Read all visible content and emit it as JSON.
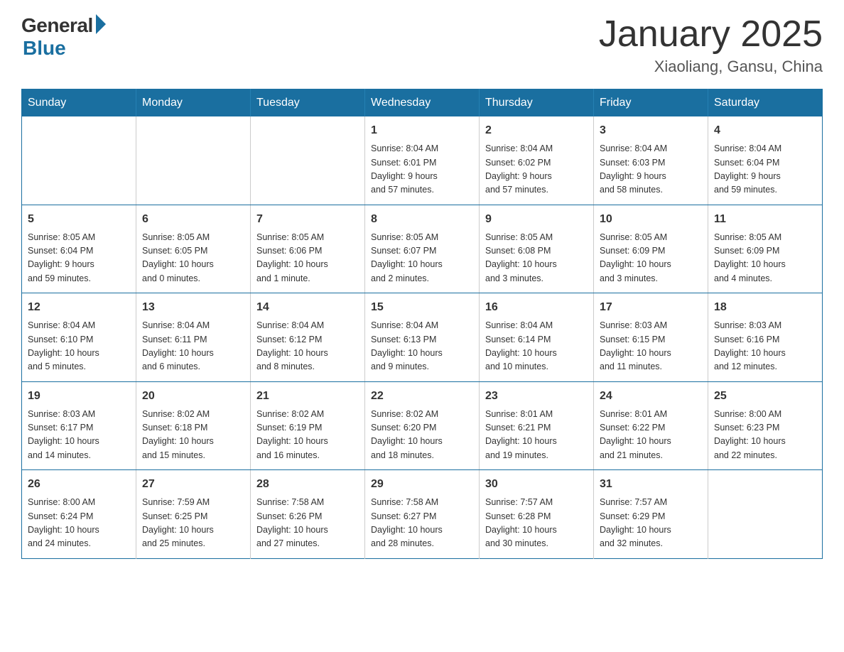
{
  "logo": {
    "general": "General",
    "blue": "Blue"
  },
  "title": "January 2025",
  "location": "Xiaoliang, Gansu, China",
  "days_of_week": [
    "Sunday",
    "Monday",
    "Tuesday",
    "Wednesday",
    "Thursday",
    "Friday",
    "Saturday"
  ],
  "weeks": [
    [
      {
        "day": "",
        "info": ""
      },
      {
        "day": "",
        "info": ""
      },
      {
        "day": "",
        "info": ""
      },
      {
        "day": "1",
        "info": "Sunrise: 8:04 AM\nSunset: 6:01 PM\nDaylight: 9 hours\nand 57 minutes."
      },
      {
        "day": "2",
        "info": "Sunrise: 8:04 AM\nSunset: 6:02 PM\nDaylight: 9 hours\nand 57 minutes."
      },
      {
        "day": "3",
        "info": "Sunrise: 8:04 AM\nSunset: 6:03 PM\nDaylight: 9 hours\nand 58 minutes."
      },
      {
        "day": "4",
        "info": "Sunrise: 8:04 AM\nSunset: 6:04 PM\nDaylight: 9 hours\nand 59 minutes."
      }
    ],
    [
      {
        "day": "5",
        "info": "Sunrise: 8:05 AM\nSunset: 6:04 PM\nDaylight: 9 hours\nand 59 minutes."
      },
      {
        "day": "6",
        "info": "Sunrise: 8:05 AM\nSunset: 6:05 PM\nDaylight: 10 hours\nand 0 minutes."
      },
      {
        "day": "7",
        "info": "Sunrise: 8:05 AM\nSunset: 6:06 PM\nDaylight: 10 hours\nand 1 minute."
      },
      {
        "day": "8",
        "info": "Sunrise: 8:05 AM\nSunset: 6:07 PM\nDaylight: 10 hours\nand 2 minutes."
      },
      {
        "day": "9",
        "info": "Sunrise: 8:05 AM\nSunset: 6:08 PM\nDaylight: 10 hours\nand 3 minutes."
      },
      {
        "day": "10",
        "info": "Sunrise: 8:05 AM\nSunset: 6:09 PM\nDaylight: 10 hours\nand 3 minutes."
      },
      {
        "day": "11",
        "info": "Sunrise: 8:05 AM\nSunset: 6:09 PM\nDaylight: 10 hours\nand 4 minutes."
      }
    ],
    [
      {
        "day": "12",
        "info": "Sunrise: 8:04 AM\nSunset: 6:10 PM\nDaylight: 10 hours\nand 5 minutes."
      },
      {
        "day": "13",
        "info": "Sunrise: 8:04 AM\nSunset: 6:11 PM\nDaylight: 10 hours\nand 6 minutes."
      },
      {
        "day": "14",
        "info": "Sunrise: 8:04 AM\nSunset: 6:12 PM\nDaylight: 10 hours\nand 8 minutes."
      },
      {
        "day": "15",
        "info": "Sunrise: 8:04 AM\nSunset: 6:13 PM\nDaylight: 10 hours\nand 9 minutes."
      },
      {
        "day": "16",
        "info": "Sunrise: 8:04 AM\nSunset: 6:14 PM\nDaylight: 10 hours\nand 10 minutes."
      },
      {
        "day": "17",
        "info": "Sunrise: 8:03 AM\nSunset: 6:15 PM\nDaylight: 10 hours\nand 11 minutes."
      },
      {
        "day": "18",
        "info": "Sunrise: 8:03 AM\nSunset: 6:16 PM\nDaylight: 10 hours\nand 12 minutes."
      }
    ],
    [
      {
        "day": "19",
        "info": "Sunrise: 8:03 AM\nSunset: 6:17 PM\nDaylight: 10 hours\nand 14 minutes."
      },
      {
        "day": "20",
        "info": "Sunrise: 8:02 AM\nSunset: 6:18 PM\nDaylight: 10 hours\nand 15 minutes."
      },
      {
        "day": "21",
        "info": "Sunrise: 8:02 AM\nSunset: 6:19 PM\nDaylight: 10 hours\nand 16 minutes."
      },
      {
        "day": "22",
        "info": "Sunrise: 8:02 AM\nSunset: 6:20 PM\nDaylight: 10 hours\nand 18 minutes."
      },
      {
        "day": "23",
        "info": "Sunrise: 8:01 AM\nSunset: 6:21 PM\nDaylight: 10 hours\nand 19 minutes."
      },
      {
        "day": "24",
        "info": "Sunrise: 8:01 AM\nSunset: 6:22 PM\nDaylight: 10 hours\nand 21 minutes."
      },
      {
        "day": "25",
        "info": "Sunrise: 8:00 AM\nSunset: 6:23 PM\nDaylight: 10 hours\nand 22 minutes."
      }
    ],
    [
      {
        "day": "26",
        "info": "Sunrise: 8:00 AM\nSunset: 6:24 PM\nDaylight: 10 hours\nand 24 minutes."
      },
      {
        "day": "27",
        "info": "Sunrise: 7:59 AM\nSunset: 6:25 PM\nDaylight: 10 hours\nand 25 minutes."
      },
      {
        "day": "28",
        "info": "Sunrise: 7:58 AM\nSunset: 6:26 PM\nDaylight: 10 hours\nand 27 minutes."
      },
      {
        "day": "29",
        "info": "Sunrise: 7:58 AM\nSunset: 6:27 PM\nDaylight: 10 hours\nand 28 minutes."
      },
      {
        "day": "30",
        "info": "Sunrise: 7:57 AM\nSunset: 6:28 PM\nDaylight: 10 hours\nand 30 minutes."
      },
      {
        "day": "31",
        "info": "Sunrise: 7:57 AM\nSunset: 6:29 PM\nDaylight: 10 hours\nand 32 minutes."
      },
      {
        "day": "",
        "info": ""
      }
    ]
  ]
}
